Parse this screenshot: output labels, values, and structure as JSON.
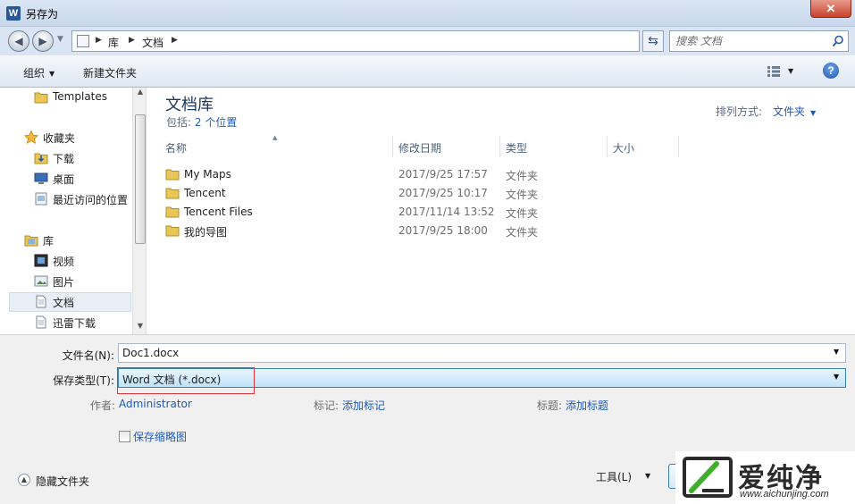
{
  "window": {
    "title": "另存为",
    "app_icon": "W",
    "close_glyph": "✕"
  },
  "nav": {
    "back_glyph": "◀",
    "forward_glyph": "▶",
    "breadcrumb": [
      "库",
      "文档"
    ],
    "search_placeholder": "搜索 文档"
  },
  "toolbar": {
    "organize": "组织",
    "new_folder": "新建文件夹",
    "help": "?"
  },
  "sidebar": {
    "items": [
      {
        "label": "Templates",
        "icon": "folder-icon"
      },
      {
        "label": "收藏夹",
        "icon": "star-icon"
      },
      {
        "label": "下载",
        "icon": "download-folder-icon"
      },
      {
        "label": "桌面",
        "icon": "desktop-icon"
      },
      {
        "label": "最近访问的位置",
        "icon": "recent-places-icon"
      },
      {
        "label": "库",
        "icon": "library-icon"
      },
      {
        "label": "视频",
        "icon": "video-icon"
      },
      {
        "label": "图片",
        "icon": "picture-icon"
      },
      {
        "label": "文档",
        "icon": "document-icon",
        "selected": true
      },
      {
        "label": "迅雷下载",
        "icon": "document-icon"
      }
    ]
  },
  "library": {
    "title": "文档库",
    "includes_label": "包括:",
    "includes_link": "2 个位置",
    "arrange_label": "排列方式:",
    "arrange_value": "文件夹"
  },
  "columns": [
    "名称",
    "修改日期",
    "类型",
    "大小"
  ],
  "files": [
    {
      "name": "My Maps",
      "date": "2017/9/25 17:57",
      "type": "文件夹"
    },
    {
      "name": "Tencent",
      "date": "2017/9/25 10:17",
      "type": "文件夹"
    },
    {
      "name": "Tencent Files",
      "date": "2017/11/14 13:52",
      "type": "文件夹"
    },
    {
      "name": "我的导图",
      "date": "2017/9/25 18:00",
      "type": "文件夹"
    }
  ],
  "form": {
    "filename_label": "文件名(N):",
    "filename_value": "Doc1.docx",
    "filetype_label": "保存类型(T):",
    "filetype_value": "Word 文档 (*.docx)",
    "author_label": "作者:",
    "author_value": "Administrator",
    "tags_label": "标记:",
    "tags_value": "添加标记",
    "subject_label": "标题:",
    "subject_value": "添加标题",
    "thumbnail_label": "保存缩略图",
    "hide_folders": "隐藏文件夹",
    "tools": "工具(L)"
  },
  "watermark": {
    "text": "爱纯净",
    "url": "www.aichunjing.com"
  },
  "colors": {
    "accent": "#1e5bb8",
    "highlight": "#e2343b",
    "titlebar": "#c8d8ec"
  }
}
